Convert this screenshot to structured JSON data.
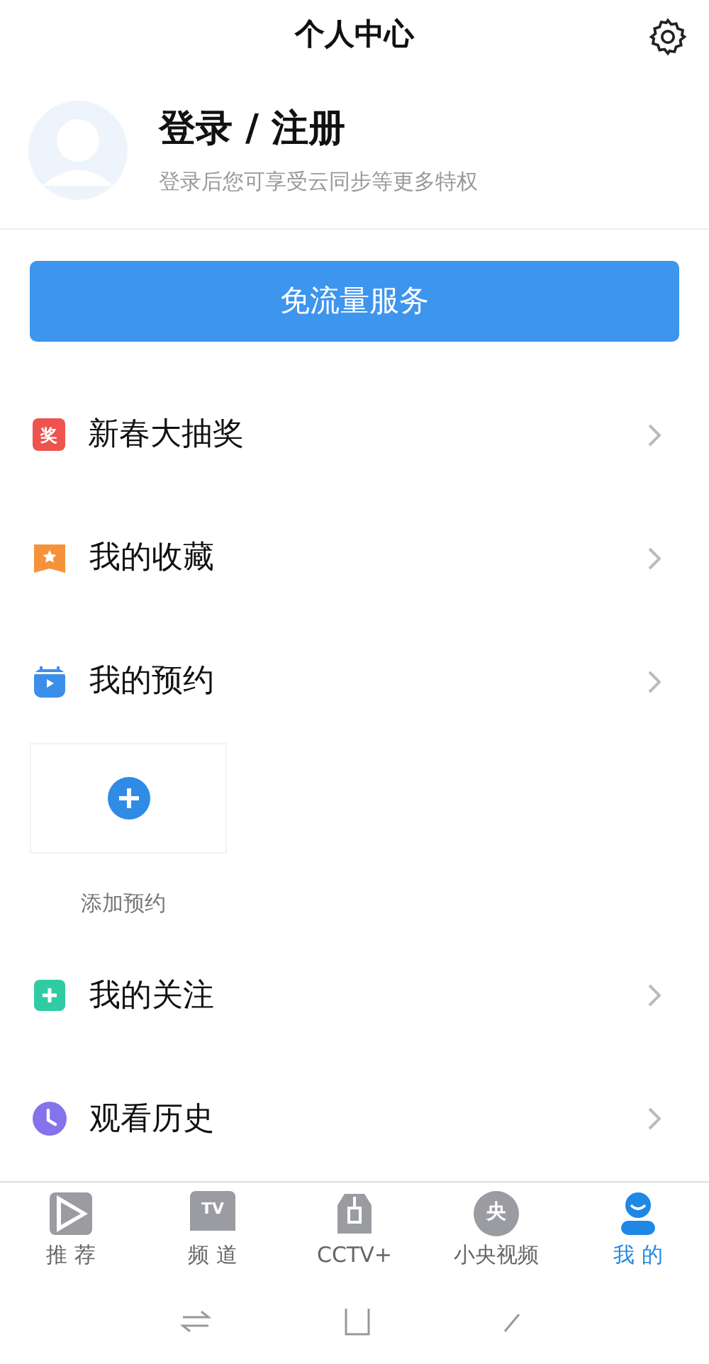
{
  "header": {
    "title": "个人中心"
  },
  "profile": {
    "name": "登录 / 注册",
    "subtitle": "登录后您可享受云同步等更多特权"
  },
  "free_data_button": "免流量服务",
  "menu": [
    {
      "kind": "prize",
      "glyph": "奖",
      "label": "新春大抽奖"
    },
    {
      "kind": "star",
      "label": "我的收藏"
    },
    {
      "kind": "calendar",
      "label": "我的预约",
      "add_card": {
        "label": "添加预约"
      }
    },
    {
      "kind": "plus",
      "label": "我的关注"
    },
    {
      "kind": "clock",
      "label": "观看历史"
    }
  ],
  "tabs": [
    {
      "kind": "play",
      "label": "推 荐",
      "selected": false
    },
    {
      "kind": "tv",
      "glyph": "TV",
      "label": "频 道",
      "selected": false
    },
    {
      "kind": "cctv",
      "label": "CCTV+",
      "selected": false
    },
    {
      "kind": "bubble",
      "glyph": "央",
      "label": "小央视频",
      "selected": false
    },
    {
      "kind": "person",
      "label": "我 的",
      "selected": true
    }
  ]
}
